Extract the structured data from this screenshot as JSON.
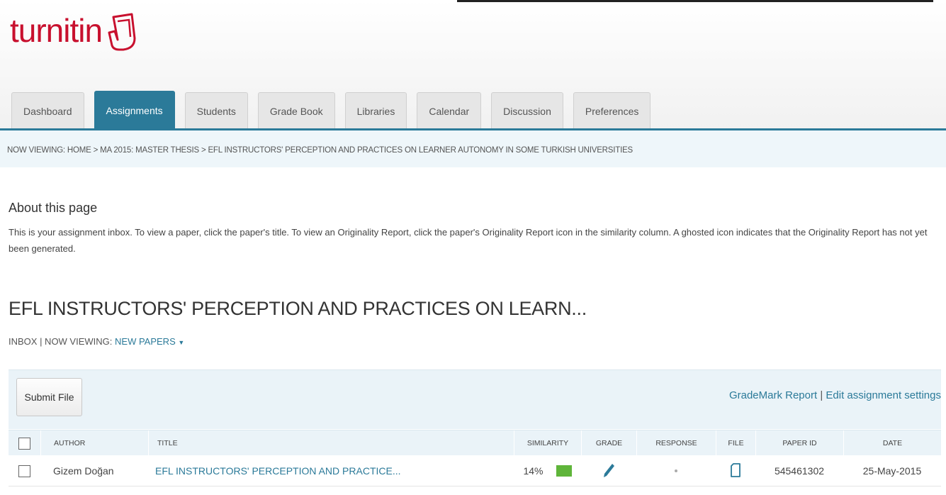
{
  "header": {
    "logo_text": "turnitin"
  },
  "tabs": [
    {
      "label": "Dashboard",
      "active": false
    },
    {
      "label": "Assignments",
      "active": true
    },
    {
      "label": "Students",
      "active": false
    },
    {
      "label": "Grade Book",
      "active": false
    },
    {
      "label": "Libraries",
      "active": false
    },
    {
      "label": "Calendar",
      "active": false
    },
    {
      "label": "Discussion",
      "active": false
    },
    {
      "label": "Preferences",
      "active": false
    }
  ],
  "breadcrumb": "NOW VIEWING: HOME > MA 2015: MASTER THESIS > EFL INSTRUCTORS' PERCEPTION AND PRACTICES ON LEARNER AUTONOMY IN SOME TURKISH UNIVERSITIES",
  "about": {
    "title": "About this page",
    "text": "This is your assignment inbox. To view a paper, click the paper's title. To view an Originality Report, click the paper's Originality Report icon in the similarity column. A ghosted icon indicates that the Originality Report has not yet been generated."
  },
  "page_title": "EFL INSTRUCTORS' PERCEPTION AND PRACTICES ON LEARN...",
  "inbox": {
    "prefix": "INBOX | NOW VIEWING:",
    "filter": "NEW PAPERS",
    "arrow": "▼"
  },
  "toolbar": {
    "submit_label": "Submit File",
    "grademark_label": "GradeMark Report",
    "separator": "|",
    "settings_label": "Edit assignment settings"
  },
  "table": {
    "headers": {
      "author": "AUTHOR",
      "title": "TITLE",
      "similarity": "SIMILARITY",
      "grade": "GRADE",
      "response": "RESPONSE",
      "file": "FILE",
      "paper_id": "PAPER ID",
      "date": "DATE"
    },
    "rows": [
      {
        "author": "Gizem Doğan",
        "title": "EFL INSTRUCTORS' PERCEPTION AND PRACTICE...",
        "similarity": "14%",
        "paper_id": "545461302",
        "date": "25-May-2015"
      }
    ]
  },
  "colors": {
    "brand_red": "#c8102e",
    "accent_blue": "#2b7a99",
    "similarity_green": "#5fb53a"
  },
  "icons": {
    "grade": "pencil-icon",
    "response": "dot-icon",
    "file": "document-icon"
  }
}
